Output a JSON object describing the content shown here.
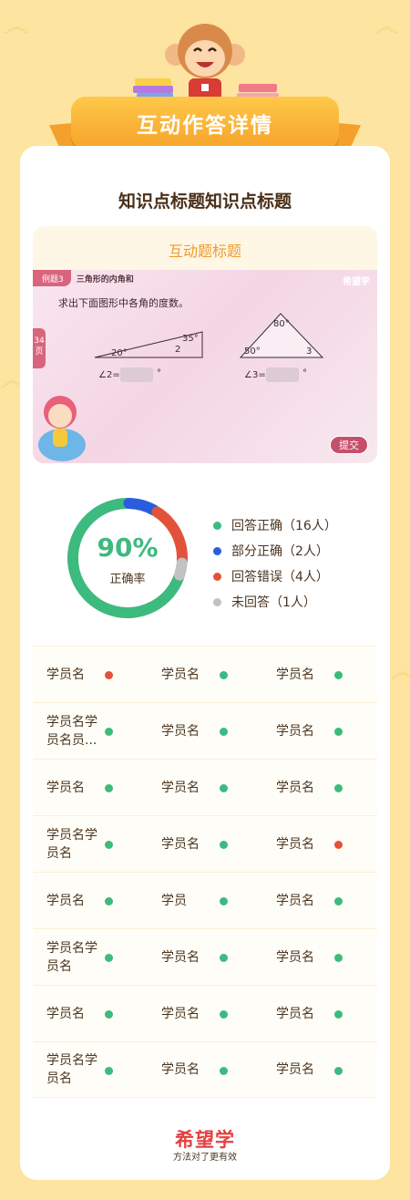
{
  "header": {
    "title": "互动作答详情"
  },
  "knowledge_point_title": "知识点标题知识点标题",
  "question": {
    "title": "互动题标题",
    "tag_number": "例题3",
    "tag_topic": "三角形的内角和",
    "brand": "希望学",
    "prompt": "求出下面图形中各角的度数。",
    "page_marker": "34页",
    "angle_a_label": "20°",
    "angle_b_label": "35°",
    "angle_c_label": "2",
    "answer1_label": "∠2=",
    "angle_top_label": "80°",
    "angle_left_label": "50°",
    "angle_right_label": "3",
    "answer2_label": "∠3=",
    "degree_mark": "°",
    "submit_label": "提交"
  },
  "stats": {
    "accuracy": "90%",
    "accuracy_label": "正确率",
    "legend": [
      {
        "label": "回答正确（16人）",
        "color": "#3dba7e",
        "count": 16
      },
      {
        "label": "部分正确（2人）",
        "color": "#2b5ce0",
        "count": 2
      },
      {
        "label": "回答错误（4人）",
        "color": "#e2523a",
        "count": 4
      },
      {
        "label": "未回答（1人）",
        "color": "#c2c2c2",
        "count": 1
      }
    ]
  },
  "colors": {
    "correct": "#3dba7e",
    "wrong": "#e2523a"
  },
  "students": [
    [
      {
        "name": "学员名",
        "status": "wrong"
      },
      {
        "name": "学员名",
        "status": "correct"
      },
      {
        "name": "学员名",
        "status": "correct"
      }
    ],
    [
      {
        "name": "学员名学员名员...",
        "status": "correct"
      },
      {
        "name": "学员名",
        "status": "correct"
      },
      {
        "name": "学员名",
        "status": "correct"
      }
    ],
    [
      {
        "name": "学员名",
        "status": "correct"
      },
      {
        "name": "学员名",
        "status": "correct"
      },
      {
        "name": "学员名",
        "status": "correct"
      }
    ],
    [
      {
        "name": "学员名学员名",
        "status": "correct"
      },
      {
        "name": "学员名",
        "status": "correct"
      },
      {
        "name": "学员名",
        "status": "wrong"
      }
    ],
    [
      {
        "name": "学员名",
        "status": "correct"
      },
      {
        "name": "学员",
        "status": "correct"
      },
      {
        "name": "学员名",
        "status": "correct"
      }
    ],
    [
      {
        "name": "学员名学员名",
        "status": "correct"
      },
      {
        "name": "学员名",
        "status": "correct"
      },
      {
        "name": "学员名",
        "status": "correct"
      }
    ],
    [
      {
        "name": "学员名",
        "status": "correct"
      },
      {
        "name": "学员名",
        "status": "correct"
      },
      {
        "name": "学员名",
        "status": "correct"
      }
    ],
    [
      {
        "name": "学员名学员名",
        "status": "correct"
      },
      {
        "name": "学员名",
        "status": "correct"
      },
      {
        "name": "学员名",
        "status": "correct"
      }
    ]
  ],
  "footer": {
    "logo": "希望学",
    "slogan": "方法对了更有效"
  }
}
